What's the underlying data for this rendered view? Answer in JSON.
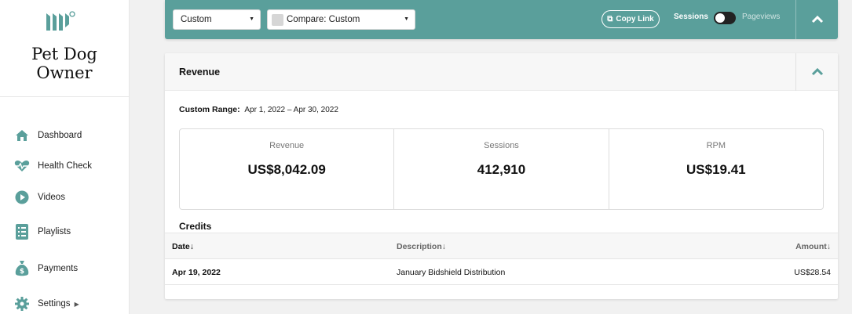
{
  "sidebar": {
    "site_name": "Pet Dog Owner",
    "items": [
      {
        "label": "Dashboard",
        "icon": "home-icon"
      },
      {
        "label": "Health Check",
        "icon": "heartbeat-icon"
      },
      {
        "label": "Videos",
        "icon": "play-icon"
      },
      {
        "label": "Playlists",
        "icon": "list-icon"
      },
      {
        "label": "Payments",
        "icon": "money-bag-icon"
      },
      {
        "label": "Settings",
        "icon": "gear-icon"
      }
    ]
  },
  "toolbar": {
    "range_select": "Custom",
    "compare_select": "Compare: Custom",
    "copy_link": "Copy Link",
    "sessions_label": "Sessions",
    "pageviews_label": "Pageviews",
    "accent": "#5a9f9b"
  },
  "panel": {
    "title": "Revenue",
    "range_label": "Custom Range:",
    "range_value": "Apr 1, 2022 – Apr 30, 2022",
    "stats": [
      {
        "label": "Revenue",
        "value": "US$8,042.09"
      },
      {
        "label": "Sessions",
        "value": "412,910"
      },
      {
        "label": "RPM",
        "value": "US$19.41"
      }
    ],
    "credits_title": "Credits",
    "table": {
      "columns": [
        "Date",
        "Description",
        "Amount"
      ],
      "rows": [
        {
          "date": "Apr 19, 2022",
          "description": "January Bidshield Distribution",
          "amount": "US$28.54"
        }
      ]
    }
  }
}
